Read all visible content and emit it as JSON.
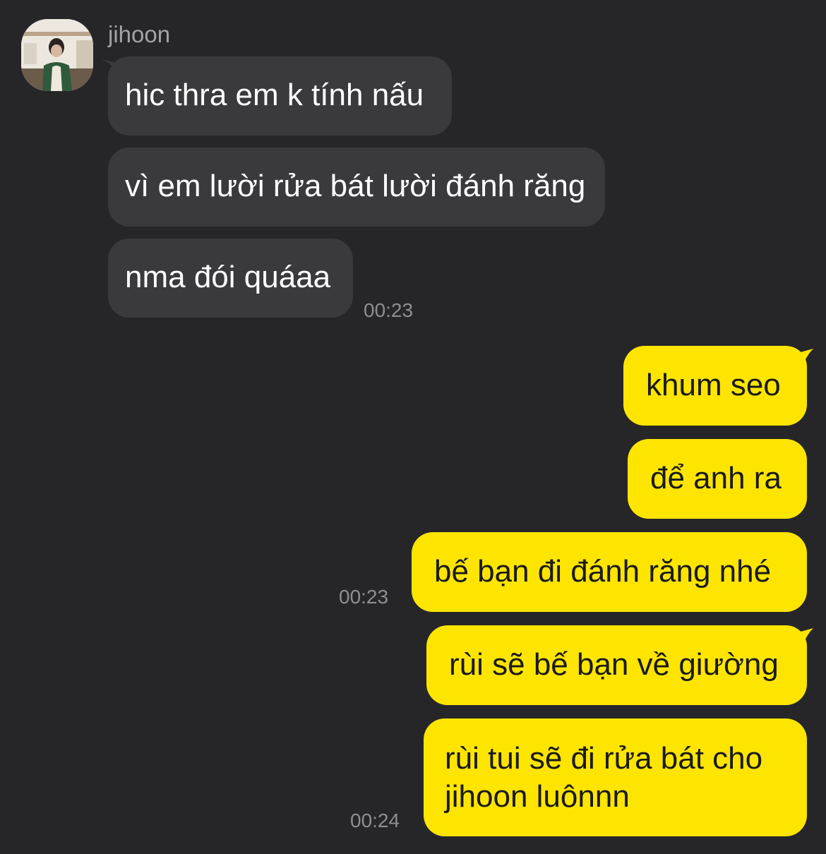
{
  "chat": {
    "sender_name": "jihoon",
    "incoming": [
      {
        "text": "hic thra em k tính nấu"
      },
      {
        "text": "vì em lười rửa bát lười đánh răng"
      },
      {
        "text": "nma đói quáaa"
      }
    ],
    "incoming_time": "00:23",
    "outgoing": [
      {
        "text": "khum seo"
      },
      {
        "text": "để anh ra"
      },
      {
        "text": "bế bạn đi đánh răng nhé"
      },
      {
        "text": "rùi sẽ bế bạn về giường"
      },
      {
        "text_line1": "rùi tui sẽ đi rửa bát cho",
        "text_line2": "jihoon luônnn"
      }
    ],
    "outgoing_time_1": "00:23",
    "outgoing_time_2": "00:24"
  },
  "colors": {
    "background": "#262628",
    "incoming_bubble": "#3a3a3d",
    "outgoing_bubble": "#fee500",
    "timestamp": "#8e8e93"
  }
}
